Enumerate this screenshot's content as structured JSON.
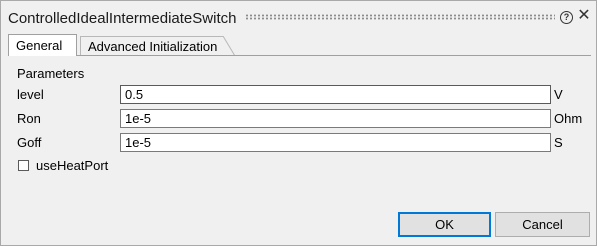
{
  "window": {
    "title": "ControlledIdealIntermediateSwitch",
    "help_icon": "question-circle-icon",
    "close_icon": "close-icon"
  },
  "tabs": [
    {
      "label": "General",
      "active": true
    },
    {
      "label": "Advanced Initialization",
      "active": false
    }
  ],
  "parameters": {
    "section_label": "Parameters",
    "rows": [
      {
        "label": "level",
        "value": "0.5",
        "unit": "V"
      },
      {
        "label": "Ron",
        "value": "1e-5",
        "unit": "Ohm"
      },
      {
        "label": "Goff",
        "value": "1e-5",
        "unit": "S"
      }
    ],
    "checkbox": {
      "label": "useHeatPort",
      "checked": false
    }
  },
  "buttons": {
    "ok_label": "OK",
    "cancel_label": "Cancel"
  }
}
